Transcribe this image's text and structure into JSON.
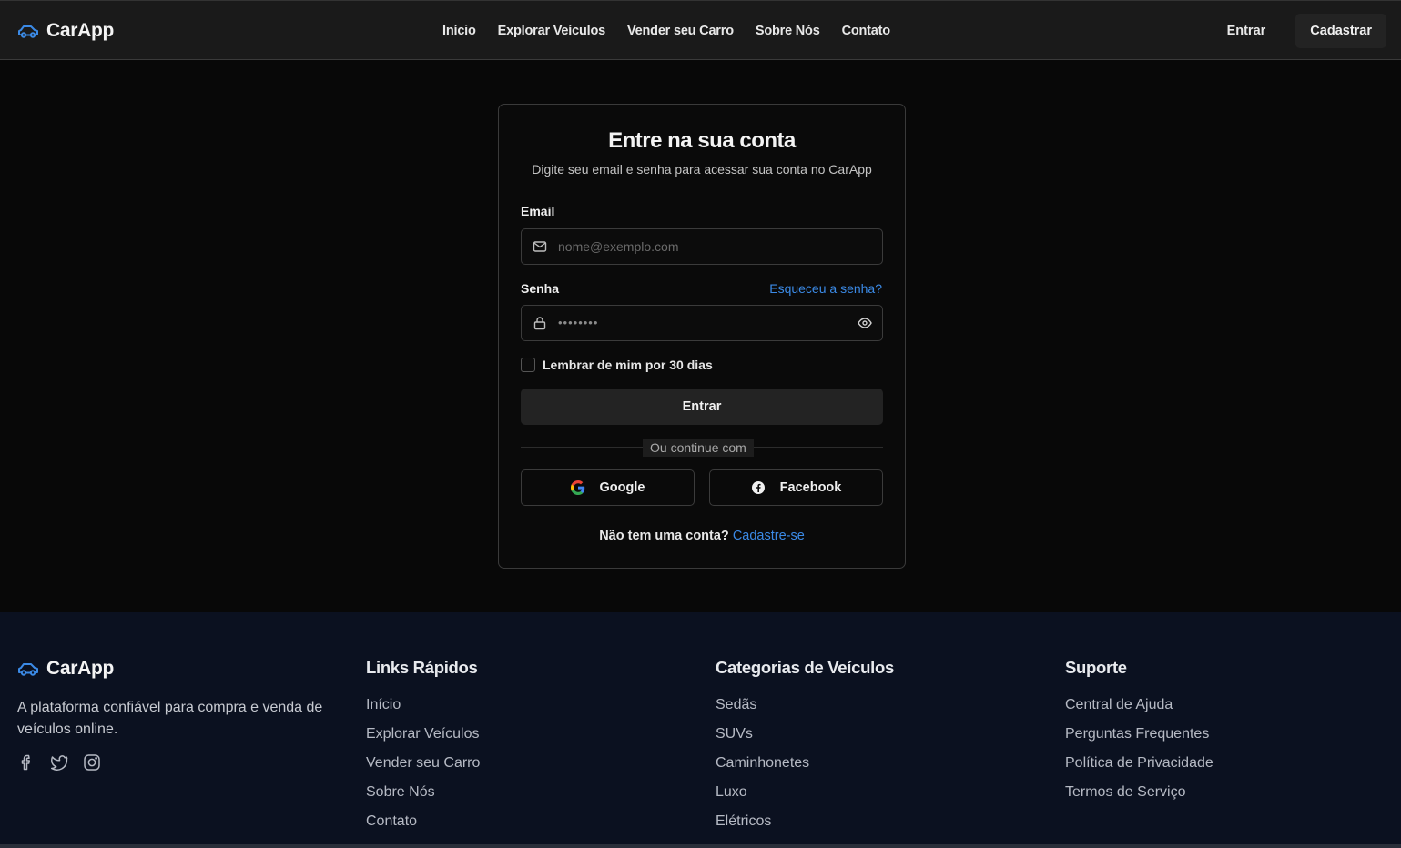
{
  "header": {
    "brand": "CarApp",
    "nav": [
      "Início",
      "Explorar Veículos",
      "Vender seu Carro",
      "Sobre Nós",
      "Contato"
    ],
    "login_label": "Entrar",
    "signup_label": "Cadastrar"
  },
  "login": {
    "title": "Entre na sua conta",
    "subtitle": "Digite seu email e senha para acessar sua conta no CarApp",
    "email_label": "Email",
    "email_placeholder": "nome@exemplo.com",
    "password_label": "Senha",
    "forgot_label": "Esqueceu a senha?",
    "password_mask": "••••••••",
    "remember_label": "Lembrar de mim por 30 dias",
    "submit_label": "Entrar",
    "divider_text": "Ou continue com",
    "google_label": "Google",
    "facebook_label": "Facebook",
    "no_account_text": "Não tem uma conta?",
    "signup_link": "Cadastre-se"
  },
  "footer": {
    "brand": "CarApp",
    "tagline": "A plataforma confiável para compra e venda de veículos online.",
    "social_icons": [
      "facebook-icon",
      "twitter-icon",
      "instagram-icon"
    ],
    "columns": [
      {
        "title": "Links Rápidos",
        "items": [
          "Início",
          "Explorar Veículos",
          "Vender seu Carro",
          "Sobre Nós",
          "Contato"
        ]
      },
      {
        "title": "Categorias de Veículos",
        "items": [
          "Sedãs",
          "SUVs",
          "Caminhonetes",
          "Luxo",
          "Elétricos"
        ]
      },
      {
        "title": "Suporte",
        "items": [
          "Central de Ajuda",
          "Perguntas Frequentes",
          "Política de Privacidade",
          "Termos de Serviço"
        ]
      }
    ]
  },
  "colors": {
    "accent": "#3b8ae6",
    "background": "#080808",
    "header_bg": "#1a1a1a",
    "footer_bg": "#0b1120"
  }
}
